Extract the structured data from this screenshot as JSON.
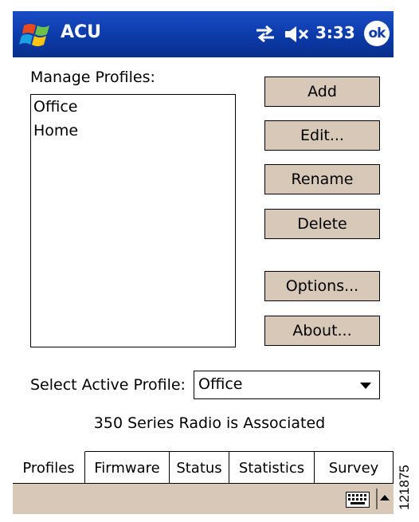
{
  "titlebar": {
    "app_title": "ACU",
    "clock": "3:33",
    "ok_label": "ok",
    "icons": [
      "windows-start-icon",
      "connectivity-icon",
      "volume-muted-icon"
    ],
    "color": "#0b3aa8"
  },
  "profiles": {
    "label": "Manage Profiles:",
    "items": [
      "Office",
      "Home"
    ]
  },
  "buttons": {
    "add": "Add",
    "edit": "Edit...",
    "rename": "Rename",
    "delete": "Delete",
    "options": "Options...",
    "about": "About..."
  },
  "active_profile": {
    "label": "Select Active Profile:",
    "value": "Office"
  },
  "status": "350 Series Radio is Associated",
  "tabs": [
    "Profiles",
    "Firmware",
    "Status",
    "Statistics",
    "Survey"
  ],
  "active_tab": "Profiles",
  "menubar": {
    "icons": [
      "keyboard-icon",
      "sip-arrow-icon"
    ],
    "color": "#d8c8b8"
  },
  "figure_number": "121875"
}
